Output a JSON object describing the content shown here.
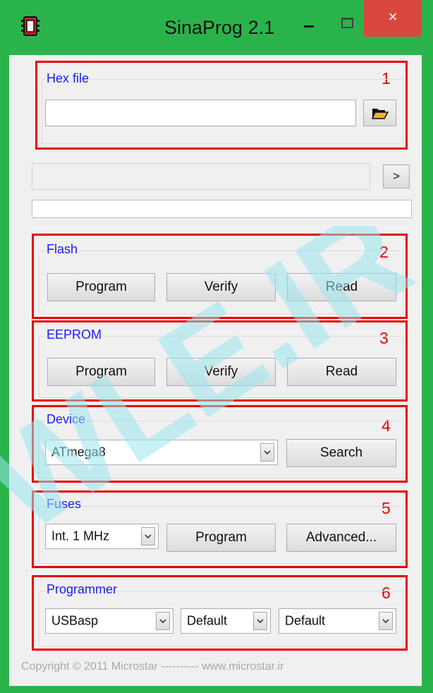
{
  "window": {
    "title": "SinaProg 2.1",
    "close_glyph": "×",
    "icon": "chip-icon"
  },
  "colors": {
    "frame": "#2bb34b",
    "annotation": "#e80000",
    "group_label": "#1a1aff",
    "close": "#d8483e",
    "watermark": "#c6f0f4"
  },
  "annotations": [
    "1",
    "2",
    "3",
    "4",
    "5",
    "6"
  ],
  "hex": {
    "label": "Hex file",
    "value": "",
    "browse_icon": "folder-open-icon"
  },
  "command": {
    "value": "",
    "send_label": ">"
  },
  "progress": {
    "value": 0
  },
  "flash": {
    "label": "Flash",
    "program": "Program",
    "verify": "Verify",
    "read": "Read"
  },
  "eeprom": {
    "label": "EEPROM",
    "program": "Program",
    "verify": "Verify",
    "read": "Read"
  },
  "device": {
    "label": "Device",
    "selected": "ATmega8",
    "search": "Search"
  },
  "fuses": {
    "label": "Fuses",
    "selected": "Int. 1 MHz",
    "program": "Program",
    "advanced": "Advanced..."
  },
  "programmer": {
    "label": "Programmer",
    "programmer": "USBasp",
    "port": "Default",
    "speed": "Default"
  },
  "footer": {
    "text": "Copyright © 2011 Microstar  ----------  www.microstar.ir"
  },
  "watermark": {
    "text": "WLE.IR"
  }
}
